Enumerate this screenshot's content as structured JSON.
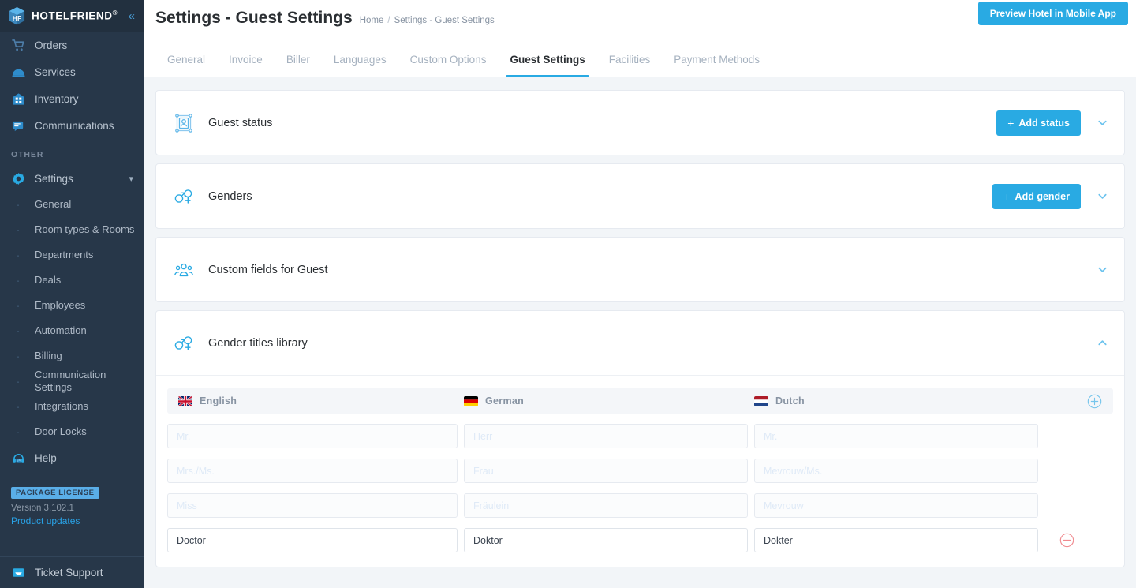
{
  "sidebar": {
    "brand": {
      "name": "HOTELFRIEND",
      "registered": "®",
      "icon": "hotelfriend-cube-logo",
      "collapse_icon": "chevron-double-left-icon"
    },
    "nav": [
      {
        "label": "Orders",
        "icon": "shopping-cart-icon"
      },
      {
        "label": "Services",
        "icon": "room-service-dome-icon"
      },
      {
        "label": "Inventory",
        "icon": "inventory-building-icon"
      },
      {
        "label": "Communications",
        "icon": "chat-bubble-icon"
      }
    ],
    "section_label": "OTHER",
    "settings": {
      "label": "Settings",
      "icon": "gear-icon",
      "chevron": "chevron-down-icon"
    },
    "sub_items": [
      {
        "label": "General"
      },
      {
        "label": "Room types & Rooms"
      },
      {
        "label": "Departments"
      },
      {
        "label": "Deals"
      },
      {
        "label": "Employees"
      },
      {
        "label": "Automation"
      },
      {
        "label": "Billing"
      },
      {
        "label": "Communication Settings"
      },
      {
        "label": "Integrations"
      },
      {
        "label": "Door Locks"
      }
    ],
    "help": {
      "label": "Help",
      "icon": "headset-24-support-icon"
    },
    "license_badge": "PACKAGE LICENSE",
    "version": "Version 3.102.1",
    "product_updates": "Product updates",
    "ticket_support": {
      "label": "Ticket Support",
      "icon": "ticket-chat-icon"
    }
  },
  "header": {
    "title": "Settings - Guest Settings",
    "breadcrumb": {
      "home": "Home",
      "separator": "/",
      "current": "Settings - Guest Settings"
    },
    "preview_button": "Preview Hotel in Mobile App"
  },
  "tabs": [
    {
      "label": "General",
      "active": false
    },
    {
      "label": "Invoice",
      "active": false
    },
    {
      "label": "Biller",
      "active": false
    },
    {
      "label": "Languages",
      "active": false
    },
    {
      "label": "Custom Options",
      "active": false
    },
    {
      "label": "Guest Settings",
      "active": true
    },
    {
      "label": "Facilities",
      "active": false
    },
    {
      "label": "Payment Methods",
      "active": false
    }
  ],
  "cards": {
    "guest_status": {
      "title": "Guest status",
      "icon": "guest-status-frame-icon",
      "button": "Add status",
      "button_plus": "+",
      "chevron": "chevron-down-icon"
    },
    "genders": {
      "title": "Genders",
      "icon": "gender-symbols-icon",
      "button": "Add gender",
      "button_plus": "+",
      "chevron": "chevron-down-icon"
    },
    "custom_fields": {
      "title": "Custom fields for Guest",
      "icon": "group-people-icon",
      "chevron": "chevron-down-icon"
    },
    "gender_titles": {
      "title": "Gender titles library",
      "icon": "gender-symbols-icon",
      "chevron": "chevron-up-icon"
    }
  },
  "titles_table": {
    "columns": [
      {
        "language": "English",
        "flag": "uk-flag"
      },
      {
        "language": "German",
        "flag": "german-flag"
      },
      {
        "language": "Dutch",
        "flag": "dutch-flag"
      }
    ],
    "add_row_icon": "plus-circle-icon",
    "remove_row_icon": "minus-circle-icon",
    "rows": [
      {
        "english": "",
        "english_placeholder": "Mr.",
        "german": "",
        "german_placeholder": "Herr",
        "dutch": "",
        "dutch_placeholder": "Mr.",
        "removable": false
      },
      {
        "english": "",
        "english_placeholder": "Mrs./Ms.",
        "german": "",
        "german_placeholder": "Frau",
        "dutch": "",
        "dutch_placeholder": "Mevrouw/Ms.",
        "removable": false
      },
      {
        "english": "",
        "english_placeholder": "Miss",
        "german": "",
        "german_placeholder": "Fräulein",
        "dutch": "",
        "dutch_placeholder": "Mevrouw",
        "removable": false
      },
      {
        "english": "Doctor",
        "english_placeholder": "",
        "german": "Doktor",
        "german_placeholder": "",
        "dutch": "Dokter",
        "dutch_placeholder": "",
        "removable": true
      }
    ]
  },
  "colors": {
    "accent": "#29aae3",
    "sidebar_bg": "#273749",
    "page_bg": "#f2f5f8",
    "danger": "#f08a8f"
  }
}
